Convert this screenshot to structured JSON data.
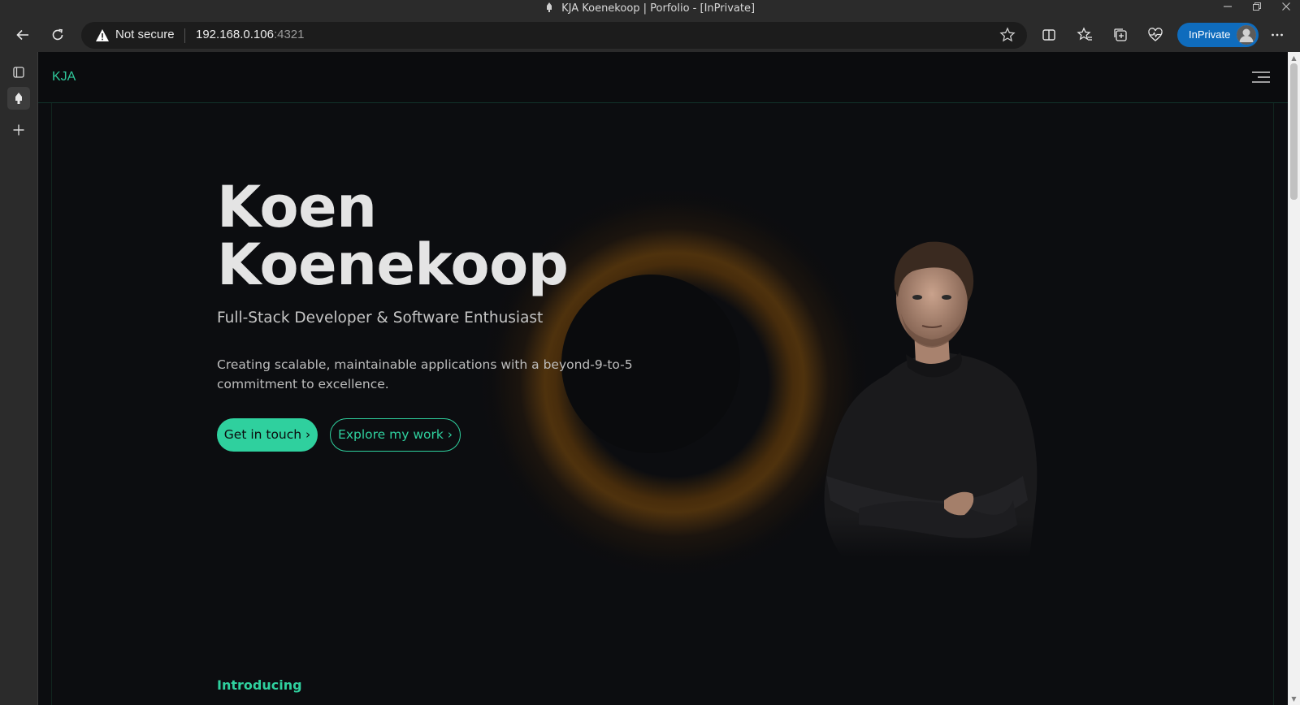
{
  "window": {
    "title": "KJA Koenekoop | Porfolio - [InPrivate]"
  },
  "toolbar": {
    "security_label": "Not secure",
    "url_host": "192.168.0.106",
    "url_port": ":4321",
    "inprivate_label": "InPrivate"
  },
  "icons": {
    "back": "back-arrow-icon",
    "reload": "reload-icon",
    "warning": "warning-triangle-icon",
    "favorite": "star-icon",
    "split": "split-screen-icon",
    "favorites": "favorites-icon",
    "collections": "collections-icon",
    "performance": "heartbeat-icon",
    "more": "more-icon"
  },
  "site": {
    "logo": "KJA",
    "hero": {
      "first_name": "Koen",
      "last_name": "Koenekoop",
      "subtitle": "Full-Stack Developer & Software Enthusiast",
      "description": "Creating scalable, maintainable applications with a beyond-9-to-5 commitment to excellence.",
      "cta_primary": "Get in touch ›",
      "cta_secondary": "Explore my work ›"
    },
    "next_section_label": "Introducing"
  },
  "colors": {
    "accent": "#2fd09e",
    "glow": "#a05f0a",
    "page_bg": "#0c0d10",
    "inprivate": "#0f6cbd"
  }
}
